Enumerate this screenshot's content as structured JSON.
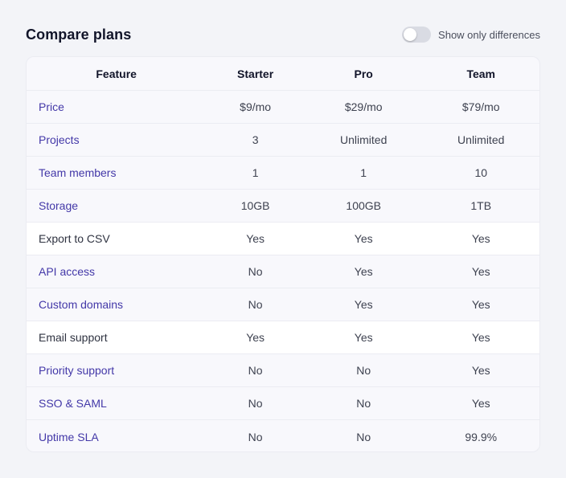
{
  "title": "Compare plans",
  "toggle": {
    "label": "Show only differences",
    "on": false
  },
  "colors": {
    "feature_diff": "#4338a8",
    "feature_same": "#2f3341",
    "row_same_bg": "#ffffff",
    "row_diff_bg": "#f8f8fc"
  },
  "table": {
    "headers": [
      "Feature",
      "Starter",
      "Pro",
      "Team"
    ],
    "rows": [
      {
        "feature": "Price",
        "values": [
          "$9/mo",
          "$29/mo",
          "$79/mo"
        ],
        "differs": true
      },
      {
        "feature": "Projects",
        "values": [
          "3",
          "Unlimited",
          "Unlimited"
        ],
        "differs": true
      },
      {
        "feature": "Team members",
        "values": [
          "1",
          "1",
          "10"
        ],
        "differs": true
      },
      {
        "feature": "Storage",
        "values": [
          "10GB",
          "100GB",
          "1TB"
        ],
        "differs": true
      },
      {
        "feature": "Export to CSV",
        "values": [
          "Yes",
          "Yes",
          "Yes"
        ],
        "differs": false
      },
      {
        "feature": "API access",
        "values": [
          "No",
          "Yes",
          "Yes"
        ],
        "differs": true
      },
      {
        "feature": "Custom domains",
        "values": [
          "No",
          "Yes",
          "Yes"
        ],
        "differs": true
      },
      {
        "feature": "Email support",
        "values": [
          "Yes",
          "Yes",
          "Yes"
        ],
        "differs": false
      },
      {
        "feature": "Priority support",
        "values": [
          "No",
          "No",
          "Yes"
        ],
        "differs": true
      },
      {
        "feature": "SSO & SAML",
        "values": [
          "No",
          "No",
          "Yes"
        ],
        "differs": true
      },
      {
        "feature": "Uptime SLA",
        "values": [
          "No",
          "No",
          "99.9%"
        ],
        "differs": true
      }
    ]
  }
}
